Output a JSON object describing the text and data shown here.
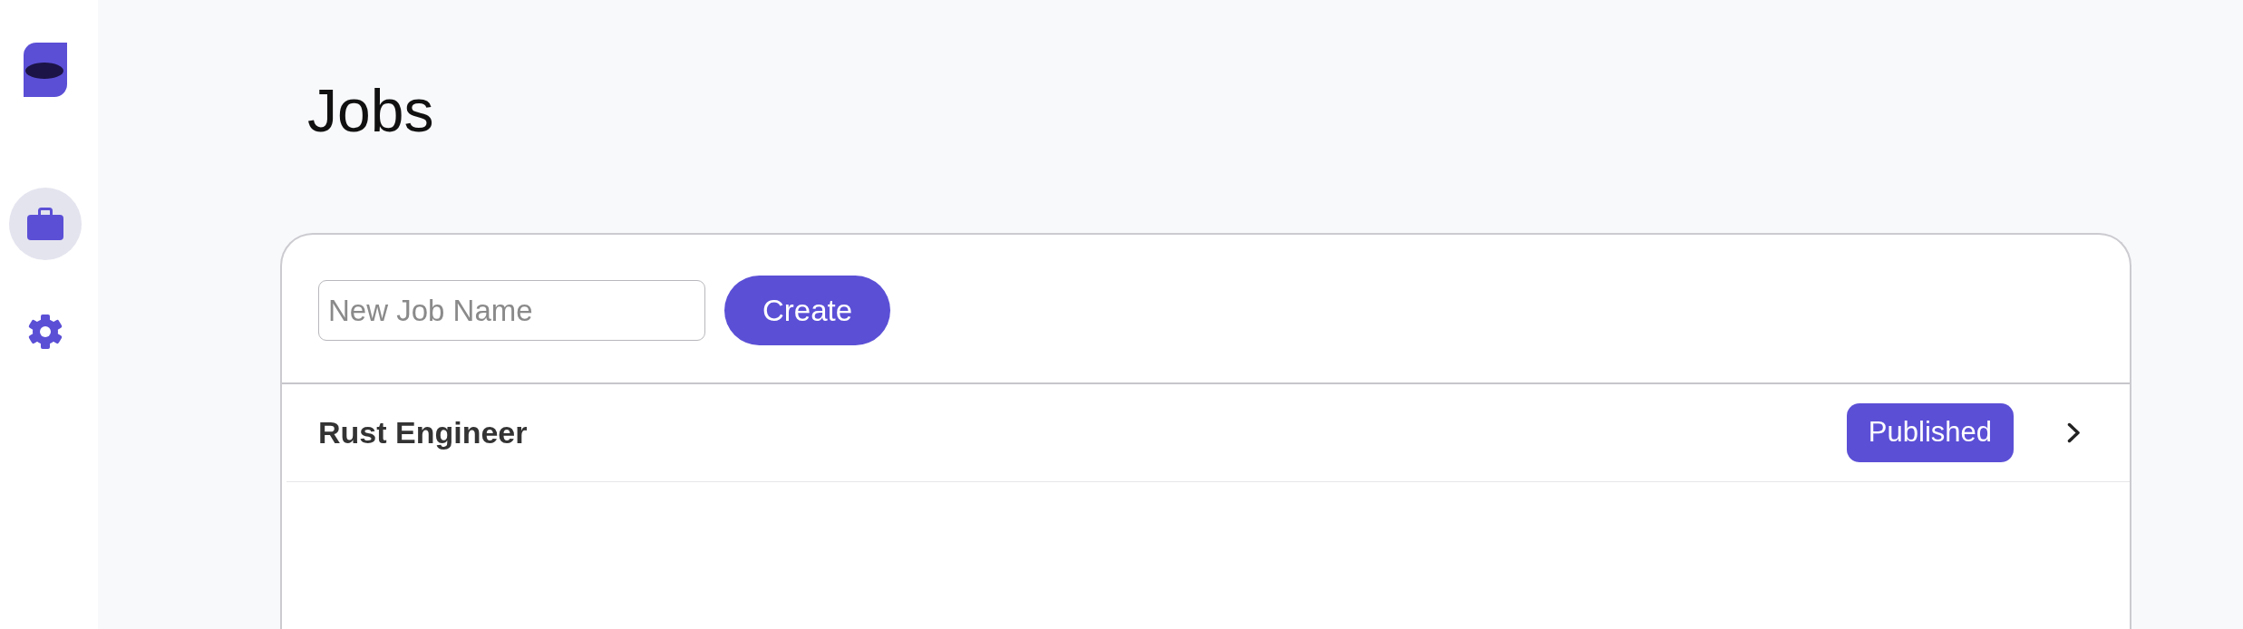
{
  "sidebar": {
    "items": [
      {
        "selected": true
      },
      {
        "selected": false
      }
    ]
  },
  "page": {
    "title": "Jobs"
  },
  "new_job": {
    "placeholder": "New Job Name",
    "button": "Create"
  },
  "jobs": [
    {
      "name": "Rust Engineer",
      "status": "Published"
    }
  ]
}
